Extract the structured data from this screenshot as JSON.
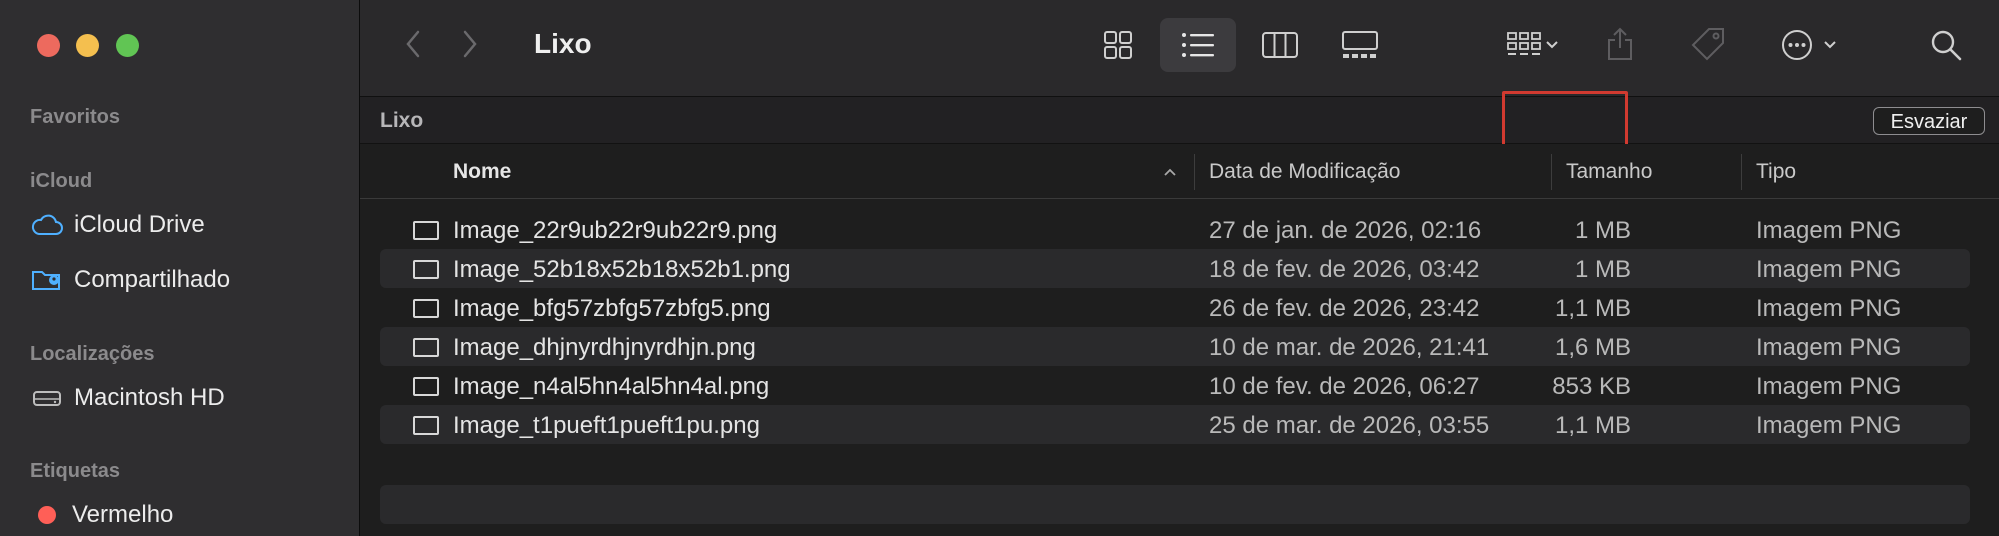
{
  "window": {
    "title": "Lixo"
  },
  "sidebar": {
    "sections": [
      {
        "label": "Favoritos",
        "items": []
      },
      {
        "label": "iCloud",
        "items": [
          {
            "label": "iCloud Drive",
            "icon": "cloud-icon"
          },
          {
            "label": "Compartilhado",
            "icon": "shared-folder-icon"
          }
        ]
      },
      {
        "label": "Localizações",
        "items": [
          {
            "label": "Macintosh HD",
            "icon": "hard-drive-icon"
          }
        ]
      },
      {
        "label": "Etiquetas",
        "items": [
          {
            "label": "Vermelho",
            "icon": "red-tag-icon",
            "color": "#ff5f57"
          }
        ]
      }
    ]
  },
  "pathbar": {
    "label": "Lixo",
    "empty_button": "Esvaziar"
  },
  "columns": {
    "name": "Nome",
    "date": "Data de Modificação",
    "size": "Tamanho",
    "kind": "Tipo"
  },
  "files": [
    {
      "name": "Image_22r9ub22r9ub22r9.png",
      "date": "27 de jan. de 2026, 02:16",
      "size": "1 MB",
      "kind": "Imagem PNG"
    },
    {
      "name": "Image_52b18x52b18x52b1.png",
      "date": "18 de fev. de 2026, 03:42",
      "size": "1 MB",
      "kind": "Imagem PNG"
    },
    {
      "name": "Image_bfg57zbfg57zbfg5.png",
      "date": "26 de fev. de 2026, 23:42",
      "size": "1,1 MB",
      "kind": "Imagem PNG"
    },
    {
      "name": "Image_dhjnyrdhjnyrdhjn.png",
      "date": "10 de mar. de 2026, 21:41",
      "size": "1,6 MB",
      "kind": "Imagem PNG"
    },
    {
      "name": "Image_n4al5hn4al5hn4al.png",
      "date": "10 de fev. de 2026, 06:27",
      "size": "853 KB",
      "kind": "Imagem PNG"
    },
    {
      "name": "Image_t1pueft1pueft1pu.png",
      "date": "25 de mar. de 2026, 03:55",
      "size": "1,1 MB",
      "kind": "Imagem PNG"
    }
  ],
  "colors": {
    "accent_highlight": "#d13a30",
    "close": "#ed6a5e",
    "minimize": "#f4bf4f",
    "zoom": "#61c554"
  }
}
